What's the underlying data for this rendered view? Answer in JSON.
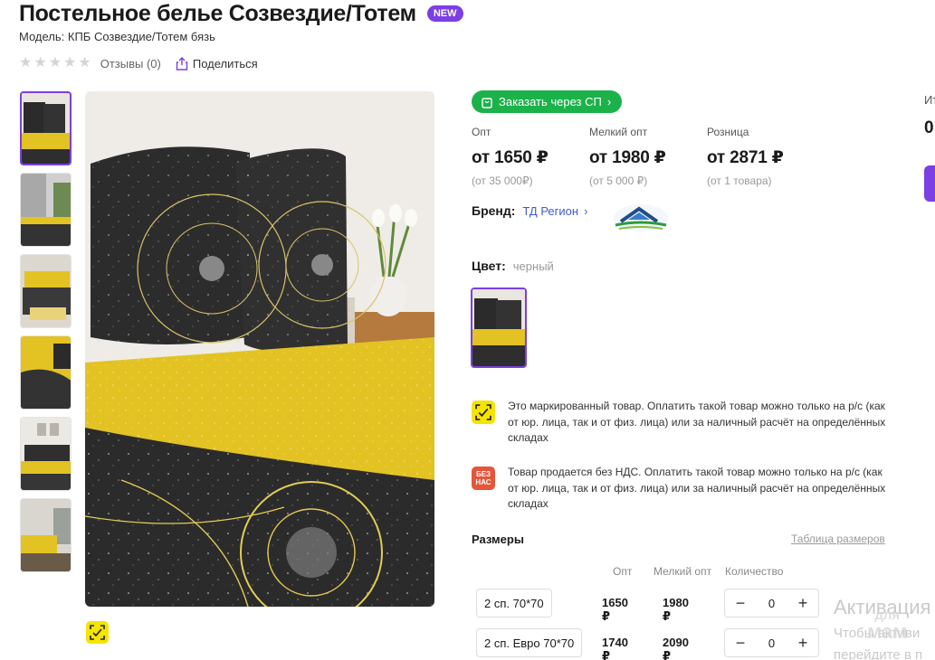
{
  "product": {
    "title": "Постельное белье Созвездие/Тотем",
    "badge": "NEW",
    "model": "Модель: КПБ Созвездие/Тотем бязь",
    "reviews": "Отзывы (0)",
    "share": "Поделиться",
    "rating": 0,
    "rating_max": 5
  },
  "order_sp": {
    "label": "Заказать через СП"
  },
  "prices": [
    {
      "label": "Опт",
      "value": "от 1650 ₽",
      "sub": "(от 35 000₽)"
    },
    {
      "label": "Мелкий опт",
      "value": "от 1980 ₽",
      "sub": "(от 5 000 ₽)"
    },
    {
      "label": "Розница",
      "value": "от 2871 ₽",
      "sub": "(от 1 товара)"
    }
  ],
  "brand": {
    "label": "Бренд:",
    "name": "ТД Регион"
  },
  "color": {
    "label": "Цвет:",
    "value": "черный"
  },
  "notices": [
    {
      "icon": "marking-icon",
      "text": "Это маркированный товар. Оплатить такой товар можно только на р/с (как от юр. лица, так и от физ. лица) или за наличный расчёт на определённых складах"
    },
    {
      "icon": "no-vat-icon",
      "icon_text": "БЕЗ НАС",
      "text": "Товар продается без НДС. Оплатить такой товар можно только на р/с (как от юр. лица, так и от физ. лица) или за наличный расчёт на определённых складах"
    }
  ],
  "sizes": {
    "title": "Размеры",
    "table_link": "Таблица размеров",
    "headers": {
      "opt": "Опт",
      "small": "Мелкий опт",
      "qty": "Количество"
    },
    "rows": [
      {
        "size": "2 сп. 70*70",
        "opt": "1650 ₽",
        "small": "1980 ₽",
        "qty": "0"
      },
      {
        "size": "2 сп. Евро 70*70",
        "opt": "1740 ₽",
        "small": "2090 ₽",
        "qty": "0"
      }
    ]
  },
  "right_cut": {
    "label": "Ит",
    "value": "0"
  },
  "watermark": {
    "line1": "Активация",
    "line2": "Чтобы активи",
    "line3": "перейдите в п",
    "logo_top": "для",
    "logo_bottom": "мам"
  },
  "colors": {
    "accent": "#7b3fe4",
    "sp_green": "#1bb24a",
    "bedding_yellow": "#e8c51f",
    "bedding_dark": "#2b2b2b"
  }
}
